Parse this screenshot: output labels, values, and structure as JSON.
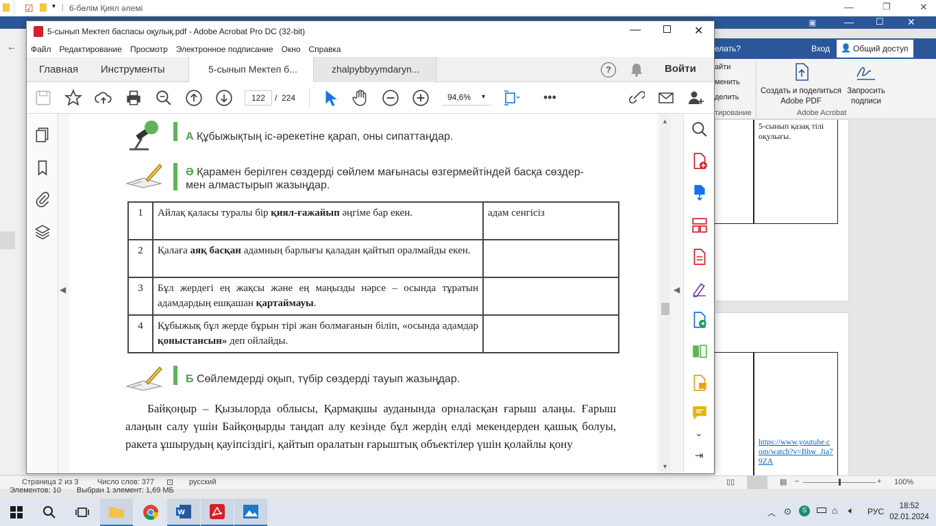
{
  "explorer": {
    "window_title": "6-бөлім Қиял әлемі",
    "status_items": "Элементов: 10",
    "status_selected": "Выбран 1 элемент: 1,69 МБ"
  },
  "word": {
    "tabs": {
      "search_hint": "елать?",
      "login": "Вход",
      "share": "Общий доступ"
    },
    "ribbon": {
      "left_items": [
        "айти",
        "менить",
        "делить"
      ],
      "left_group": "тирование",
      "create_share_pdf": "Создать и поделиться Adobe PDF",
      "request_signatures": "Запросить подписи",
      "group_label": "Adobe Acrobat"
    },
    "doc": {
      "cell_text": "5-сынып қазақ тілі оқулығы.",
      "link": "https://www.youtube.com/watch?v=Bhw_Jia79ZA"
    },
    "status": {
      "page": "Страница 2 из 3",
      "words": "Число слов: 377",
      "lang": "русский",
      "zoom": "100%"
    }
  },
  "acrobat": {
    "window_title": "5-сынып Мектеп баспасы оқулық.pdf - Adobe Acrobat Pro DC (32-bit)",
    "menu": [
      "Файл",
      "Редактирование",
      "Просмотр",
      "Электронное подписание",
      "Окно",
      "Справка"
    ],
    "nav_tabs": {
      "home": "Главная",
      "tools": "Инструменты"
    },
    "doc_tabs": [
      "5-сынып Мектеп б...",
      "zhalpybbyymdaryn..."
    ],
    "sign_in": "Войти",
    "page_current": "122",
    "page_separator": "/",
    "page_total": "224",
    "zoom": "94,6%"
  },
  "pdf": {
    "task_a": {
      "letter": "А",
      "text": "Құбыжықтың іс-әрекетіне қарап, оны сипаттаңдар."
    },
    "task_ae": {
      "letter": "Ә",
      "text_line1": "Қарамен берілген сөздерді сөйлем мағынасы өзгермейтіндей басқа сөздер-",
      "text_line2": "мен алмастырып жазыңдар."
    },
    "table": [
      {
        "num": "1",
        "before": "Айлақ қаласы туралы бір ",
        "bold": "қиял-ғажайып",
        "after": " әңгіме бар екен.",
        "answer": "адам сенгісіз"
      },
      {
        "num": "2",
        "before": "Қалаға ",
        "bold": "аяқ басқан",
        "after": " адамның барлығы қаладан қайтып оралмайды екен.",
        "answer": ""
      },
      {
        "num": "3",
        "before": "Бұл жердегі ең жақсы және ең маңызды нәрсе – осында тұратын адамдардың ешқашан ",
        "bold": "қартаймауы",
        "after": ".",
        "answer": ""
      },
      {
        "num": "4",
        "before": "Құбыжық бұл жерде бұрын тірі жан болмағанын біліп, «осында адамдар ",
        "bold": "қоныстансын»",
        "after": " деп ойлайды.",
        "answer": ""
      }
    ],
    "task_b": {
      "letter": "Б",
      "text": "Сөйлемдерді оқып, түбір сөздерді тауып жазыңдар."
    },
    "paragraph": "Байқоңыр – Қызылорда облысы, Қармақшы ауданында орналасқан ғарыш алаңы. Ғарыш алаңын салу үшін Байқоңырды таңдап алу кезінде бұл жердің елді мекендерден қашық болуы, ракета ұшырудың қауіпсіздігі, қайтып оралатын ғарыштық объектілер үшін қолайлы қону"
  },
  "taskbar": {
    "lang": "РУС",
    "time": "18:52",
    "date": "02.01.2024"
  },
  "colors": {
    "word_blue": "#2b579a",
    "acrobat_red": "#d4202a",
    "task_green": "#5fb35a",
    "toolbar_blue": "#1473e6"
  }
}
